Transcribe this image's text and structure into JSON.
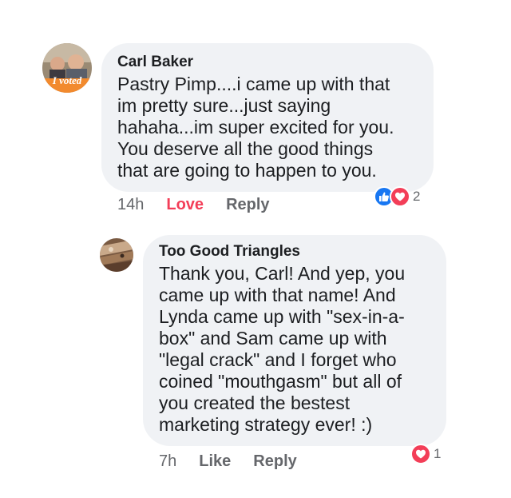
{
  "comments": [
    {
      "author": "Carl Baker",
      "avatar_badge": "I voted",
      "lines": [
        "Pastry Pimp....i came up with that",
        "im pretty sure...just saying",
        "hahaha...im super excited for you.",
        "You deserve all the good things",
        "that are going to happen to you."
      ],
      "timestamp": "14h",
      "like_label": "Love",
      "reply_label": "Reply",
      "reaction_icons": [
        "like-icon",
        "love-icon"
      ],
      "reaction_count": "2",
      "liked_with_love": true
    },
    {
      "author": "Too Good Triangles",
      "lines": [
        "Thank you, Carl! And yep, you",
        "came up with that name! And",
        "Lynda came up with \"sex-in-a-",
        "box\" and Sam came up with",
        "\"legal crack\" and I forget who",
        "coined \"mouthgasm\" but all of",
        "you created the bestest",
        "marketing strategy ever! :)"
      ],
      "timestamp": "7h",
      "like_label": "Like",
      "reply_label": "Reply",
      "reaction_icons": [
        "love-icon"
      ],
      "reaction_count": "1"
    }
  ],
  "colors": {
    "bubble": "#f0f2f5",
    "love": "#f33e58",
    "like_blue": "#1877f2",
    "meta_gray": "#65676b"
  }
}
